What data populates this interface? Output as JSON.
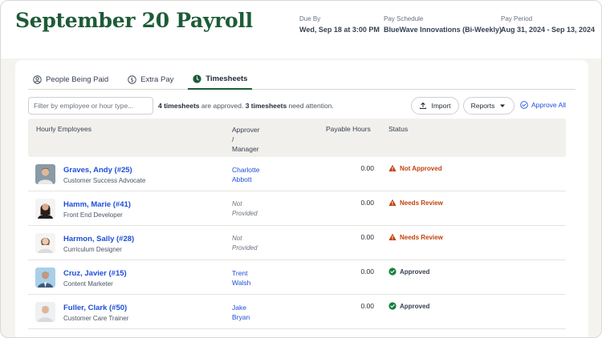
{
  "header": {
    "title": "September 20 Payroll",
    "due_by_label": "Due By",
    "due_by_value": "Wed, Sep 18 at 3:00 PM",
    "schedule_label": "Pay Schedule",
    "schedule_value": "BlueWave Innovations (Bi-Weekly)",
    "period_label": "Pay Period",
    "period_value": "Aug 31, 2024 - Sep 13, 2024"
  },
  "tabs": [
    {
      "label": "People Being Paid",
      "icon": "person-icon",
      "active": false
    },
    {
      "label": "Extra Pay",
      "icon": "dollar-icon",
      "active": false
    },
    {
      "label": "Timesheets",
      "icon": "clock-icon",
      "active": true
    }
  ],
  "toolbar": {
    "filter_placeholder": "Filter by employee or hour type...",
    "summary_approved": "4 timesheets",
    "summary_mid": " are approved. ",
    "summary_attention": "3 timesheets",
    "summary_end": " need attention.",
    "import_label": "Import",
    "reports_label": "Reports",
    "approve_all_label": "Approve All"
  },
  "table": {
    "columns": {
      "employees": "Hourly Employees",
      "approver_line1": "Approver",
      "approver_line2": "/",
      "approver_line3": "Manager",
      "hours": "Payable Hours",
      "status": "Status"
    },
    "rows": [
      {
        "name": "Graves, Andy (#25)",
        "role": "Customer Success Advocate",
        "approver_1": "Charlotte",
        "approver_2": "Abbott",
        "approver_provided": true,
        "hours": "0.00",
        "status": "Not Approved",
        "status_kind": "warning"
      },
      {
        "name": "Hamm, Marie (#41)",
        "role": "Front End Developer",
        "approver_1": "Not",
        "approver_2": "Provided",
        "approver_provided": false,
        "hours": "0.00",
        "status": "Needs Review",
        "status_kind": "warning"
      },
      {
        "name": "Harmon, Sally (#28)",
        "role": "Curriculum Designer",
        "approver_1": "Not",
        "approver_2": "Provided",
        "approver_provided": false,
        "hours": "0.00",
        "status": "Needs Review",
        "status_kind": "warning"
      },
      {
        "name": "Cruz, Javier (#15)",
        "role": "Content Marketer",
        "approver_1": "Trent",
        "approver_2": "Walsh",
        "approver_provided": true,
        "hours": "0.00",
        "status": "Approved",
        "status_kind": "ok"
      },
      {
        "name": "Fuller, Clark (#50)",
        "role": "Customer Care Trainer",
        "approver_1": "Jake",
        "approver_2": "Bryan",
        "approver_provided": true,
        "hours": "0.00",
        "status": "Approved",
        "status_kind": "ok"
      }
    ]
  },
  "colors": {
    "brand_green": "#1d5b38",
    "link_blue": "#1d4ed8",
    "warning_orange": "#c2410c",
    "ok_green": "#15803d"
  }
}
